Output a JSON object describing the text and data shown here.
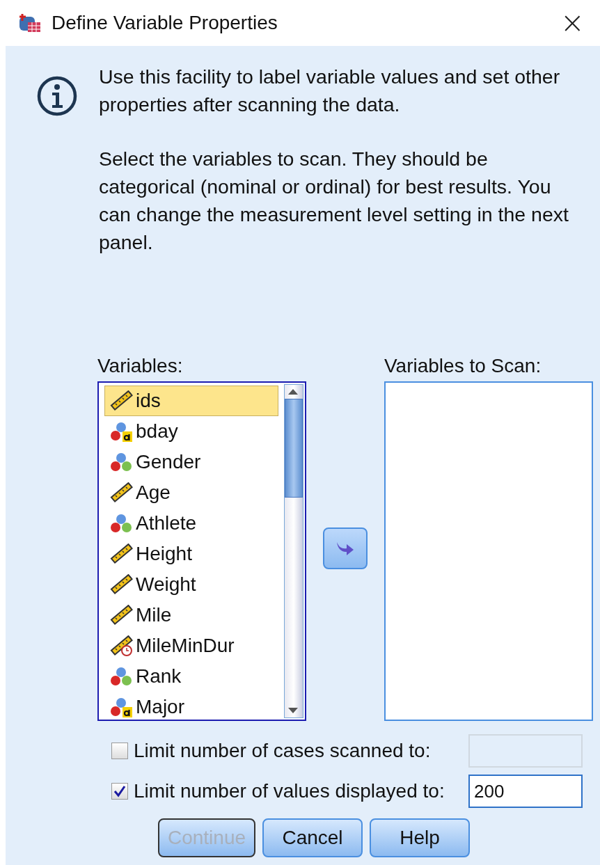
{
  "window": {
    "title": "Define Variable Properties",
    "close": "×"
  },
  "intro": {
    "paragraphs": [
      "Use this facility to label variable values and set other properties after scanning the data.",
      "Select the variables to scan. They should be categorical (nominal or ordinal) for best results. You can change the measurement level setting in the next panel."
    ]
  },
  "variables": {
    "label": "Variables:",
    "items": [
      {
        "name": "ids",
        "kind": "scale",
        "selected": true
      },
      {
        "name": "bday",
        "kind": "nominal_string",
        "selected": false
      },
      {
        "name": "Gender",
        "kind": "nominal",
        "selected": false
      },
      {
        "name": "Age",
        "kind": "scale",
        "selected": false
      },
      {
        "name": "Athlete",
        "kind": "nominal",
        "selected": false
      },
      {
        "name": "Height",
        "kind": "scale",
        "selected": false
      },
      {
        "name": "Weight",
        "kind": "scale",
        "selected": false
      },
      {
        "name": "Mile",
        "kind": "scale",
        "selected": false
      },
      {
        "name": "MileMinDur",
        "kind": "scale_time",
        "selected": false
      },
      {
        "name": "Rank",
        "kind": "nominal",
        "selected": false
      },
      {
        "name": "Major",
        "kind": "nominal_string",
        "selected": false
      }
    ]
  },
  "scan": {
    "label": "Variables to Scan:"
  },
  "options": [
    {
      "label": "Limit number of cases scanned to:",
      "checked": false,
      "value_disabled": true
    },
    {
      "label": "Limit number of values displayed to:",
      "checked": true,
      "value": "200",
      "value_disabled": false
    }
  ],
  "buttons": [
    {
      "label": "Continue",
      "disabled": true
    },
    {
      "label": "Cancel",
      "disabled": false
    },
    {
      "label": "Help",
      "disabled": false
    }
  ]
}
